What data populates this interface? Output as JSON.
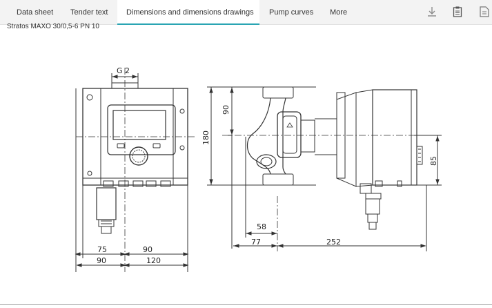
{
  "tabs": [
    {
      "label": "Data sheet",
      "active": false
    },
    {
      "label": "Tender text",
      "active": false
    },
    {
      "label": "Dimensions and dimensions drawings",
      "active": true
    },
    {
      "label": "Pump curves",
      "active": false
    },
    {
      "label": "More",
      "active": false
    }
  ],
  "toolbar": {
    "icons": [
      "download-icon",
      "clipboard-icon",
      "document-icon"
    ]
  },
  "product": {
    "name": "Stratos MAXO 30/0,5-6 PN 10"
  },
  "drawing": {
    "labels": {
      "g_thread": "G 2",
      "d90_front_left": "75",
      "d90_front_right": "90",
      "d90_bottom_left": "90",
      "d120_bottom_right": "120",
      "h180": "180",
      "h90": "90",
      "d58": "58",
      "d77": "77",
      "d252": "252",
      "h85": "85"
    }
  },
  "colors": {
    "accent": "#2aa5b3",
    "tabbar": "#f3f3f3",
    "line": "#333333"
  }
}
